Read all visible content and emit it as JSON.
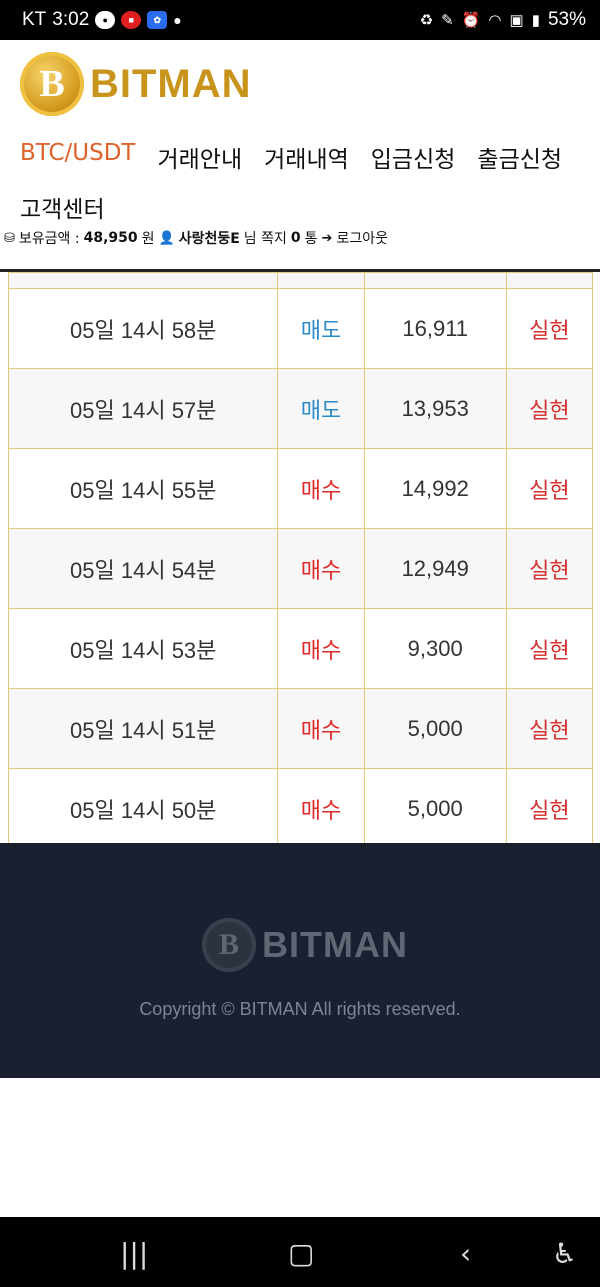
{
  "status_bar": {
    "carrier": "KT",
    "time": "3:02",
    "notif_icons": [
      "talk-icon",
      "m-icon",
      "paw-icon"
    ],
    "battery": "53%"
  },
  "header": {
    "logo_letter": "B",
    "logo_text": "BITMAN",
    "nav": [
      {
        "label": "BTC/USDT",
        "active": true
      },
      {
        "label": "거래안내"
      },
      {
        "label": "거래내역"
      },
      {
        "label": "입금신청"
      },
      {
        "label": "출금신청"
      },
      {
        "label": "고객센터"
      }
    ],
    "user": {
      "balance_label": "보유금액 :",
      "balance_value": "48,950",
      "balance_unit": "원",
      "username": "사랑천둥E",
      "honorific": "님 쪽지",
      "message_count": "0",
      "message_unit": "통",
      "logout": "로그아웃"
    }
  },
  "trades": [
    {
      "time": "05일 14시 58분",
      "type": "매도",
      "kind": "sell",
      "amount": "16,911",
      "result": "실현"
    },
    {
      "time": "05일 14시 57분",
      "type": "매도",
      "kind": "sell",
      "amount": "13,953",
      "result": "실현"
    },
    {
      "time": "05일 14시 55분",
      "type": "매수",
      "kind": "buy",
      "amount": "14,992",
      "result": "실현"
    },
    {
      "time": "05일 14시 54분",
      "type": "매수",
      "kind": "buy",
      "amount": "12,949",
      "result": "실현"
    },
    {
      "time": "05일 14시 53분",
      "type": "매수",
      "kind": "buy",
      "amount": "9,300",
      "result": "실현"
    },
    {
      "time": "05일 14시 51분",
      "type": "매수",
      "kind": "buy",
      "amount": "5,000",
      "result": "실현"
    },
    {
      "time": "05일 14시 50분",
      "type": "매수",
      "kind": "buy",
      "amount": "5,000",
      "result": "실현"
    }
  ],
  "footer": {
    "logo_letter": "B",
    "logo_text": "BITMAN",
    "copyright": "Copyright © BITMAN All rights reserved."
  },
  "colors": {
    "brand_gold": "#c9941b",
    "nav_active": "#e0622a",
    "sell": "#2d8bc9",
    "buy": "#e02a2a",
    "footer_bg": "#1b2030"
  }
}
